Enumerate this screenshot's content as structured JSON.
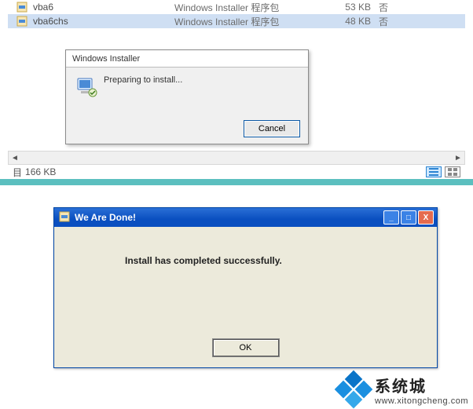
{
  "explorer": {
    "rows": [
      {
        "name": "vba6",
        "type": "Windows Installer 程序包",
        "size": "53 KB",
        "flag": "否",
        "selected": false
      },
      {
        "name": "vba6chs",
        "type": "Windows Installer 程序包",
        "size": "48 KB",
        "flag": "否",
        "selected": true
      }
    ],
    "status_left_prefix": "目",
    "status_size": "166 KB"
  },
  "installer_dialog": {
    "title": "Windows Installer",
    "message": "Preparing to install...",
    "cancel_label": "Cancel"
  },
  "done_dialog": {
    "title": "We Are Done!",
    "message": "Install has completed successfully.",
    "ok_label": "OK"
  },
  "watermark": {
    "brand_cn": "系统城",
    "brand_url": "www.xitongcheng.com"
  }
}
